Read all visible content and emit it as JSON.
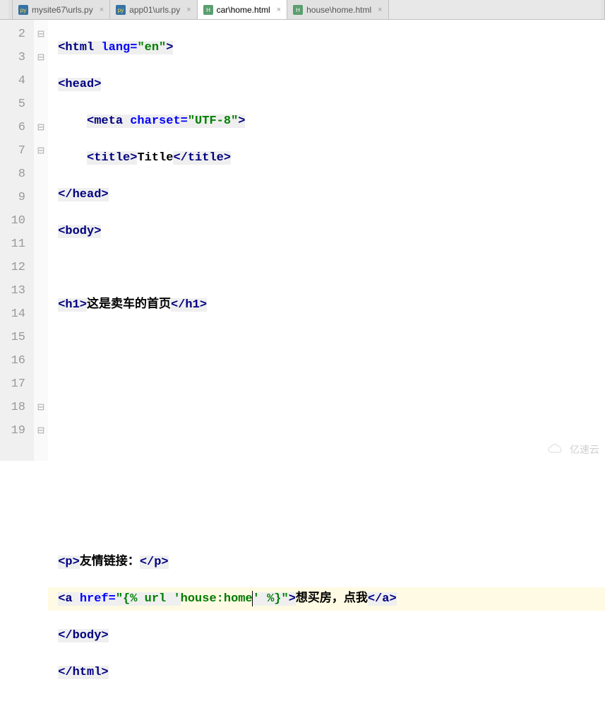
{
  "tabs": [
    {
      "label": "mysite67\\urls.py",
      "icon": "py"
    },
    {
      "label": "app01\\urls.py",
      "icon": "py"
    },
    {
      "label": "car\\home.html",
      "icon": "html",
      "active": true
    },
    {
      "label": "house\\home.html",
      "icon": "html"
    }
  ],
  "lines": {
    "start": 2,
    "end": 19
  },
  "code": {
    "l2": {
      "tag_open": "<html ",
      "attr": "lang=",
      "val": "\"en\"",
      "tag_close": ">"
    },
    "l3": {
      "tag": "<head>"
    },
    "l4": {
      "tag_open": "<meta ",
      "attr": "charset=",
      "val": "\"UTF-8\"",
      "tag_close": ">"
    },
    "l5": {
      "open": "<title>",
      "text": "Title",
      "close": "</title>"
    },
    "l6": {
      "tag": "</head>"
    },
    "l7": {
      "tag": "<body>"
    },
    "l9": {
      "open": "<h1>",
      "text": "这是卖车的首页",
      "close": "</h1>"
    },
    "l16": {
      "open": "<p>",
      "text": "友情链接：",
      "close": "</p>"
    },
    "l17": {
      "open": "<a ",
      "attr": "href=",
      "q": "\"",
      "tmpl_open": "{% ",
      "url": "url ",
      "sq": "'",
      "name": "house:home",
      "sq2": "'",
      "tmpl_close": " %}",
      "q2": "\"",
      "gt": ">",
      "text": "想买房，点我",
      "close": "</a>"
    },
    "l18": {
      "tag": "</body>"
    },
    "l19": {
      "tag": "</html>"
    }
  },
  "line_numbers": [
    "2",
    "3",
    "4",
    "5",
    "6",
    "7",
    "8",
    "9",
    "10",
    "11",
    "12",
    "13",
    "14",
    "15",
    "16",
    "17",
    "18",
    "19"
  ],
  "fold_marks": {
    "2": "⊟",
    "3": "⊟",
    "6": "⊟",
    "7": "⊟",
    "18": "⊟",
    "19": "⊟"
  },
  "watermark": "亿速云"
}
